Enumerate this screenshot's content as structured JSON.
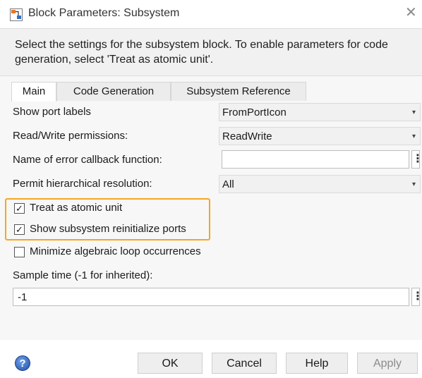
{
  "window": {
    "title": "Block Parameters: Subsystem",
    "close_symbol": "✕"
  },
  "description": "Select the settings for the subsystem block. To enable parameters for code generation, select 'Treat as atomic unit'.",
  "tabs": [
    {
      "label": "Main",
      "active": true
    },
    {
      "label": "Code Generation",
      "active": false
    },
    {
      "label": "Subsystem Reference",
      "active": false
    }
  ],
  "params": {
    "show_port_labels": {
      "label": "Show port labels",
      "value": "FromPortIcon"
    },
    "rw_permissions": {
      "label": "Read/Write permissions:",
      "value": "ReadWrite"
    },
    "error_callback": {
      "label": "Name of error callback function:",
      "value": ""
    },
    "hier_resolution": {
      "label": "Permit hierarchical resolution:",
      "value": "All"
    },
    "treat_atomic": {
      "label": "Treat as atomic unit",
      "checked": true
    },
    "reinit_ports": {
      "label": "Show subsystem reinitialize ports",
      "checked": true
    },
    "minimize_loop": {
      "label": "Minimize algebraic loop occurrences",
      "checked": false
    },
    "sample_time": {
      "label": "Sample time (-1 for inherited):",
      "value": "-1"
    }
  },
  "buttons": {
    "ok": "OK",
    "cancel": "Cancel",
    "help": "Help",
    "apply": "Apply"
  },
  "symbols": {
    "dropdown": "▾",
    "check": "✓",
    "more": "⋮",
    "help_icon": "?"
  },
  "colors": {
    "highlight": "#f5a623",
    "help_icon": "#2a5cb8"
  }
}
